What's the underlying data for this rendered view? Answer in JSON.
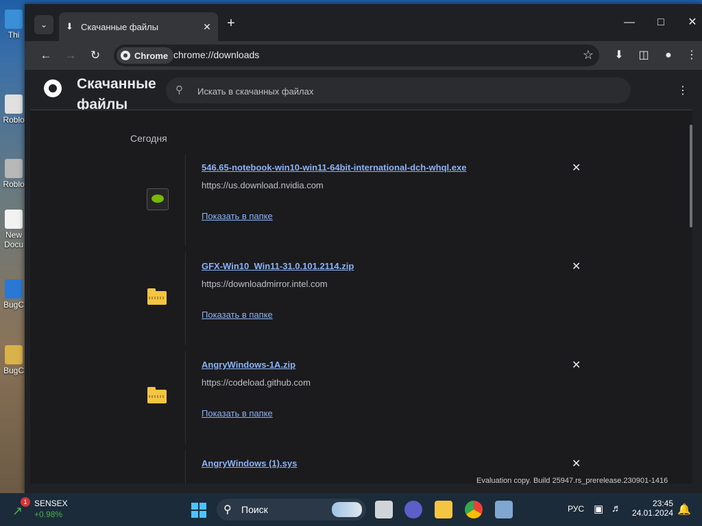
{
  "desktop": {
    "icons": [
      "Thi",
      "Roblo",
      "Roblo",
      "New\nDocu",
      "BugC",
      "BugC"
    ]
  },
  "window": {
    "tab_title": "Скачанные файлы",
    "address": "chrome://downloads",
    "chip_label": "Chrome"
  },
  "page": {
    "title": "Скачанные файлы",
    "search_placeholder": "Искать в скачанных файлах",
    "date_group": "Сегодня",
    "downloads": [
      {
        "name": "546.65-notebook-win10-win11-64bit-international-dch-whql.exe",
        "source": "https://us.download.nvidia.com",
        "action": "Показать в папке",
        "icon": "nvidia-icon"
      },
      {
        "name": "GFX-Win10_Win11-31.0.101.2114.zip",
        "source": "https://downloadmirror.intel.com",
        "action": "Показать в папке",
        "icon": "zip-folder-icon"
      },
      {
        "name": "AngryWindows-1A.zip",
        "source": "https://codeload.github.com",
        "action": "Показать в папке",
        "icon": "zip-folder-icon"
      },
      {
        "name": "AngryWindows (1).sys",
        "source": "",
        "action": "",
        "icon": "file-icon"
      }
    ]
  },
  "watermark": "Evaluation copy. Build 25947.rs_prerelease.230901-1416",
  "taskbar": {
    "stock_name": "SENSEX",
    "stock_change": "+0.98%",
    "stock_badge": "1",
    "search_label": "Поиск",
    "lang": "РУС",
    "time": "23:45",
    "date": "24.01.2024"
  }
}
